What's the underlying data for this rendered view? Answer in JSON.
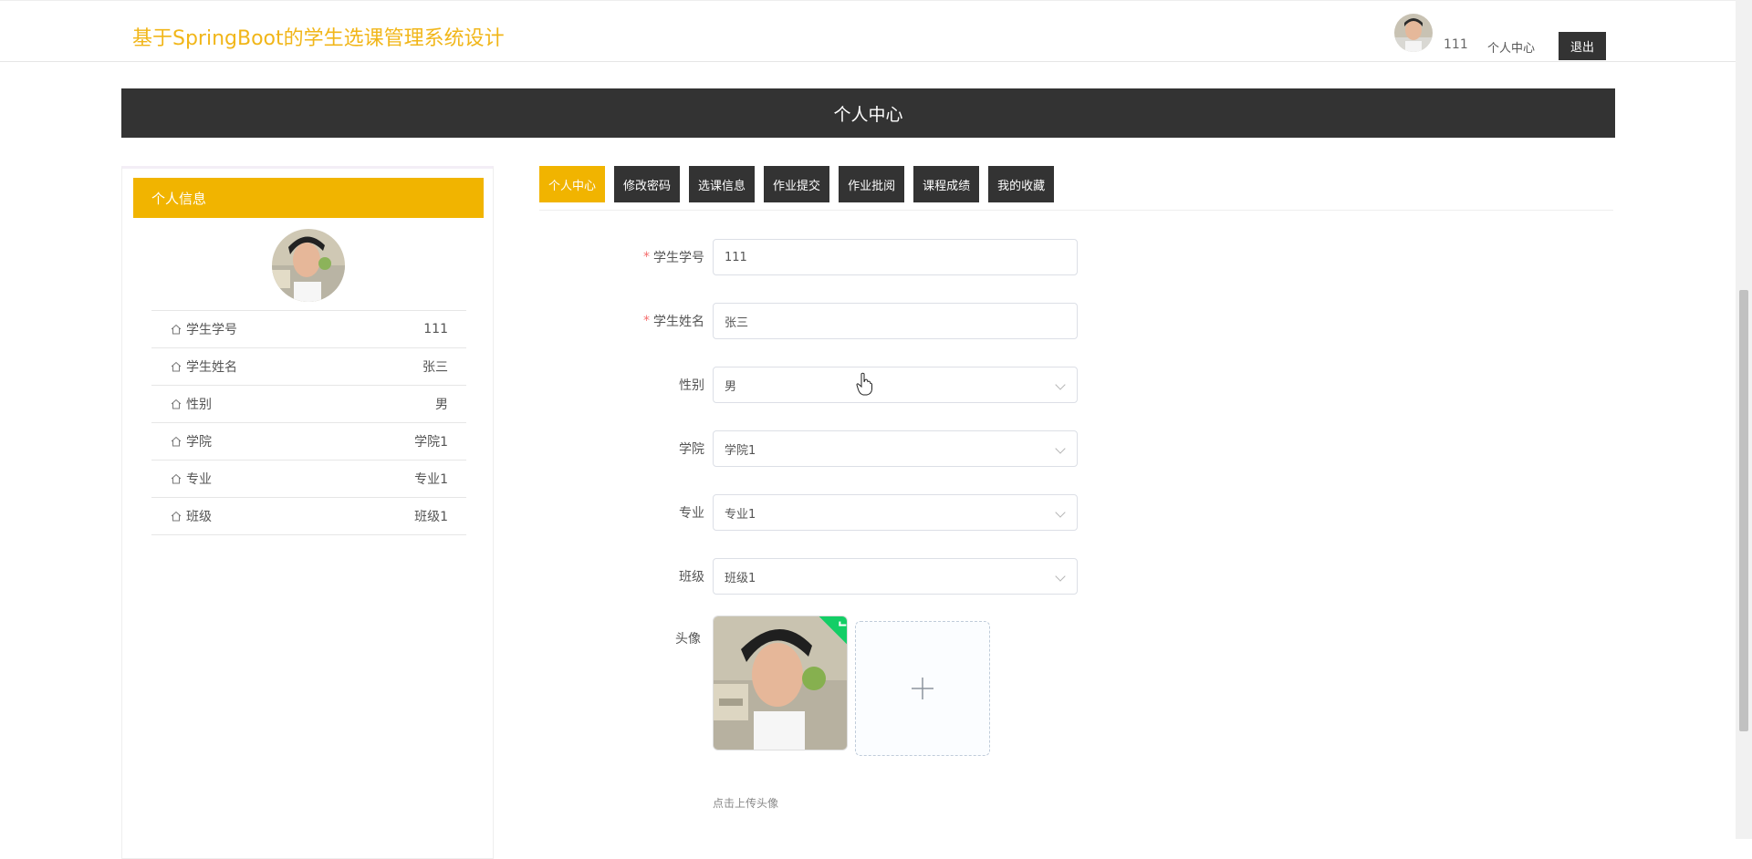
{
  "header": {
    "site_title": "基于SpringBoot的学生选课管理系统设计",
    "username": "111",
    "center_link": "个人中心",
    "logout_label": "退出"
  },
  "banner": {
    "title": "个人中心"
  },
  "sidebar": {
    "heading": "个人信息",
    "rows": [
      {
        "label": "学生学号",
        "value": "111"
      },
      {
        "label": "学生姓名",
        "value": "张三"
      },
      {
        "label": "性别",
        "value": "男"
      },
      {
        "label": "学院",
        "value": "学院1"
      },
      {
        "label": "专业",
        "value": "专业1"
      },
      {
        "label": "班级",
        "value": "班级1"
      }
    ]
  },
  "tabs": [
    {
      "label": "个人中心",
      "active": true
    },
    {
      "label": "修改密码"
    },
    {
      "label": "选课信息"
    },
    {
      "label": "作业提交"
    },
    {
      "label": "作业批阅"
    },
    {
      "label": "课程成绩"
    },
    {
      "label": "我的收藏"
    }
  ],
  "form": {
    "student_no": {
      "label": "学生学号",
      "value": "111",
      "required": true
    },
    "student_name": {
      "label": "学生姓名",
      "value": "张三",
      "required": true
    },
    "gender": {
      "label": "性别",
      "value": "男"
    },
    "college": {
      "label": "学院",
      "value": "学院1"
    },
    "major": {
      "label": "专业",
      "value": "专业1"
    },
    "class": {
      "label": "班级",
      "value": "班级1"
    },
    "avatar": {
      "label": "头像",
      "tip": "点击上传头像"
    }
  },
  "colors": {
    "accent": "#f1b400",
    "dark": "#333333",
    "title": "#f1b619"
  },
  "icons": {
    "row_icon": "home-icon",
    "add_icon": "plus-icon",
    "dropdown_icon": "chevron-down-icon"
  }
}
